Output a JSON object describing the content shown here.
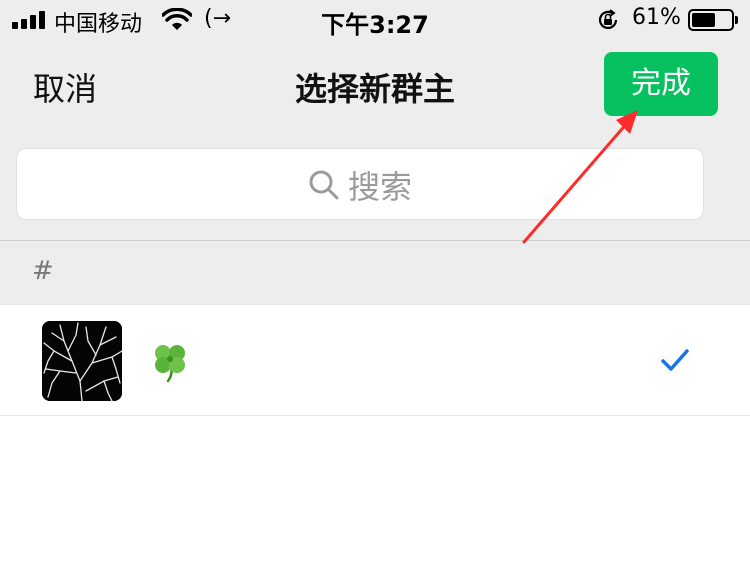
{
  "status_bar": {
    "carrier": "中国移动",
    "call_forward": "(→",
    "time": "下午3:27",
    "battery_percent": "61%",
    "battery_level": 0.61,
    "signal_bars": 4
  },
  "nav": {
    "cancel_label": "取消",
    "title": "选择新群主",
    "done_label": "完成"
  },
  "search": {
    "placeholder": "搜索"
  },
  "list": {
    "section_header": "#",
    "members": [
      {
        "name_icon": "four-leaf-clover-emoji",
        "avatar": "dark-tree-branches-photo",
        "selected": true
      }
    ]
  },
  "colors": {
    "accent_green": "#07c160",
    "background_gray": "#ededed",
    "check_blue": "#1a73e8",
    "annotation_red": "#ff2a2a"
  }
}
